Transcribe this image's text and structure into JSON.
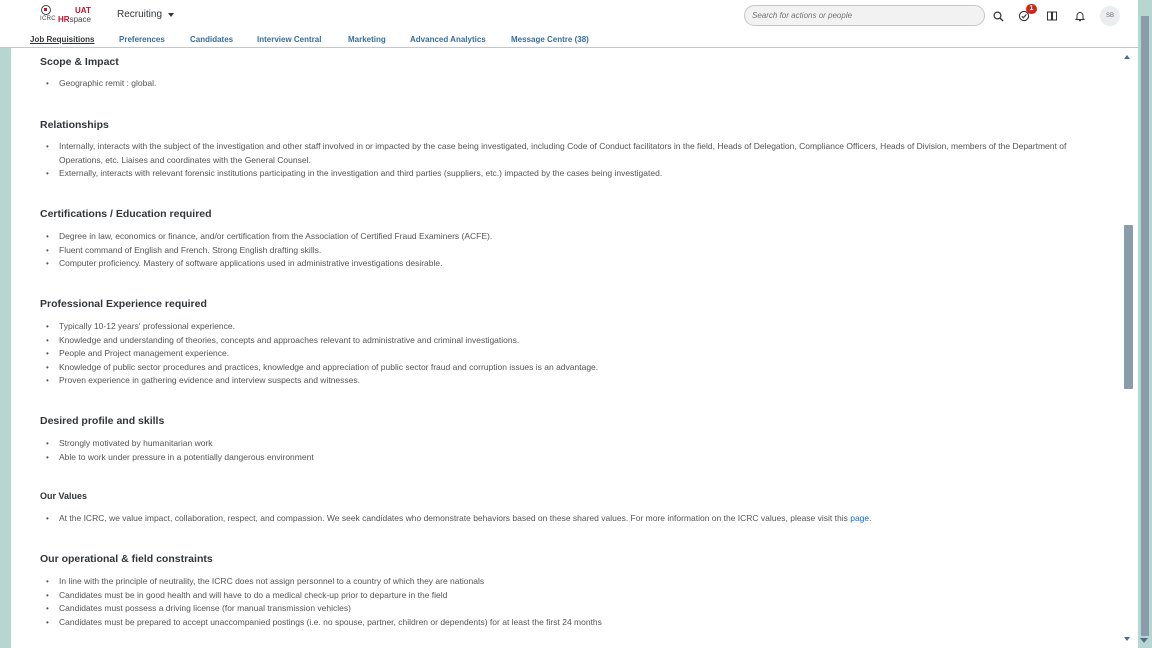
{
  "header": {
    "logo": {
      "mark_text": "ICRC",
      "uat": "UAT",
      "hr": "HR",
      "space": "space"
    },
    "app_title": "Recruiting",
    "search_placeholder": "Search for actions or people",
    "notification_count": "1",
    "avatar_initials": "SB"
  },
  "nav": {
    "tabs": [
      {
        "label": "Job Requisitions",
        "active": true
      },
      {
        "label": "Preferences"
      },
      {
        "label": "Candidates"
      },
      {
        "label": "Interview Central"
      },
      {
        "label": "Marketing"
      },
      {
        "label": "Advanced Analytics"
      },
      {
        "label": "Message Centre (38)"
      }
    ]
  },
  "sections": {
    "scope": {
      "title": "Scope & Impact",
      "items": [
        "Geographic remit : global."
      ]
    },
    "relationships": {
      "title": "Relationships",
      "items": [
        "Internally, interacts with the subject of the investigation and other staff involved in or impacted by the case being investigated, including Code of Conduct facilitators in the field, Heads of Delegation, Compliance Officers, Heads of Division, members of the Department of Operations, etc. Liaises and coordinates with the General Counsel.",
        "Externally, interacts with relevant forensic institutions participating in the investigation and third parties (suppliers, etc.) impacted by the cases being investigated."
      ]
    },
    "certifications": {
      "title": "Certifications / Education required",
      "items": [
        "Degree in law, economics or finance, and/or certification from the Association of Certified Fraud Examiners (ACFE).",
        "Fluent command of English and French. Strong English drafting skills.",
        "Computer proficiency. Mastery of software applications used in administrative investigations desirable."
      ]
    },
    "experience": {
      "title": "Professional Experience required",
      "items": [
        "Typically 10-12 years' professional experience.",
        "Knowledge and understanding of theories, concepts and approaches relevant to administrative and criminal investigations.",
        "People and Project management experience.",
        "Knowledge of public sector procedures and practices, knowledge and appreciation of public sector fraud and corruption issues is an advantage.",
        "Proven experience in gathering evidence and interview suspects and witnesses."
      ]
    },
    "profile": {
      "title": "Desired profile and skills",
      "items": [
        "Strongly motivated by humanitarian work",
        "Able to work under pressure in a potentially dangerous environment"
      ]
    },
    "values": {
      "title": "Our Values",
      "text": "At the ICRC, we value impact, collaboration, respect, and compassion. We seek candidates who demonstrate behaviors based on these shared values. For more information on the ICRC values, please visit this ",
      "link": "page",
      "suffix": "."
    },
    "constraints": {
      "title": "Our operational & field constraints",
      "items": [
        "In line with the principle of neutrality, the ICRC does not assign personnel to a country of which they are nationals",
        "Candidates must be in good health and will have to do a medical check-up prior to departure in the field",
        "Candidates must possess a driving license (for manual transmission vehicles)",
        "Candidates must be prepared to accept unaccompanied postings (i.e. no spouse, partner, children or dependents) for at least the first 24 months"
      ]
    }
  },
  "colors": {
    "side_bars": "#b6d7cf",
    "link": "#0a6ed1",
    "tab": "#3a6e99",
    "badge": "#d0271d",
    "brand_red": "#c8102e"
  }
}
